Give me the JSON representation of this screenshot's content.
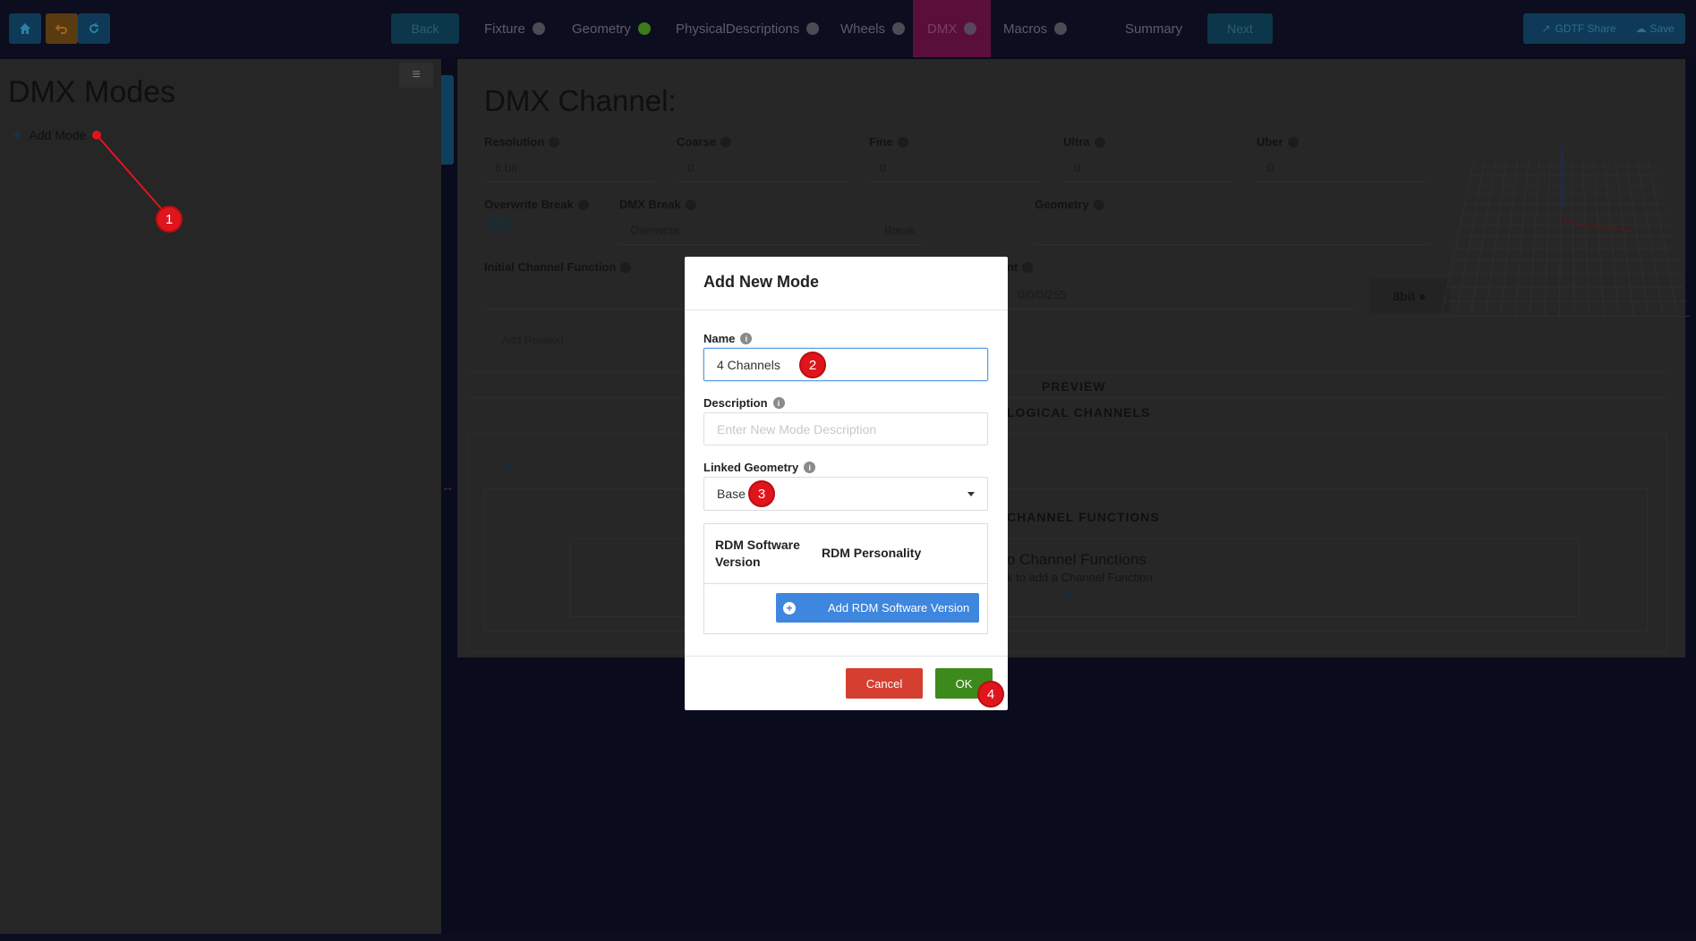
{
  "topbar": {
    "back_label": "Back",
    "next_label": "Next",
    "share_label": "GDTF Share",
    "save_label": "Save",
    "tabs": [
      {
        "label": "Fixture",
        "status": "gray"
      },
      {
        "label": "Geometry",
        "status": "green"
      },
      {
        "label": "PhysicalDescriptions",
        "status": "gray"
      },
      {
        "label": "Wheels",
        "status": "gray"
      },
      {
        "label": "DMX",
        "status": "gray",
        "active": true
      },
      {
        "label": "Macros",
        "status": "gray"
      },
      {
        "label": "Summary"
      }
    ]
  },
  "left": {
    "title": "DMX Modes",
    "add_mode_label": "Add Mode",
    "menu_icon": "≡"
  },
  "right": {
    "title": "DMX Channel:",
    "resolution_label": "Resolution",
    "resolution_value": "8 bit",
    "coarse_label": "Coarse",
    "coarse_value": "0",
    "fine_label": "Fine",
    "fine_value": "0",
    "ultra_label": "Ultra",
    "ultra_value": "0",
    "uber_label": "Uber",
    "uber_value": "0",
    "overwrite_break_label": "Overwrite Break",
    "dmx_break_label": "DMX Break",
    "dmx_break_placeholder": "Overwrite",
    "dmx_break_suffix": "Break",
    "geometry_label": "Geometry",
    "initial_cf_label": "Initial Channel Function",
    "highlight_label": "nt",
    "highlight_value": "0/0/0/255",
    "bit_button": "8bit",
    "add_relation": "Add Relation",
    "preview_label": "PREVIEW",
    "logical_channels_label": "LOGICAL CHANNELS",
    "channel_functions_label": "CHANNEL FUNCTIONS",
    "no_cf_title": "o Channel Functions",
    "no_cf_sub": "k to add a Channel Function"
  },
  "modal": {
    "title": "Add New Mode",
    "name_label": "Name",
    "name_value": "4 Channels",
    "description_label": "Description",
    "description_placeholder": "Enter New Mode Description",
    "linked_geometry_label": "Linked Geometry",
    "linked_geometry_value": "Base",
    "rdm_software_version_header": "RDM Software Version",
    "rdm_personality_header": "RDM Personality",
    "add_rdm_button": "Add RDM Software Version",
    "cancel_label": "Cancel",
    "ok_label": "OK"
  },
  "steps": [
    "1",
    "2",
    "3",
    "4"
  ],
  "colors": {
    "accent_blue": "#3e86de",
    "cancel_red": "#d43f2f",
    "ok_green": "#3c8a1c",
    "step_red": "#e0151c",
    "active_tab": "#5a0f3a"
  }
}
